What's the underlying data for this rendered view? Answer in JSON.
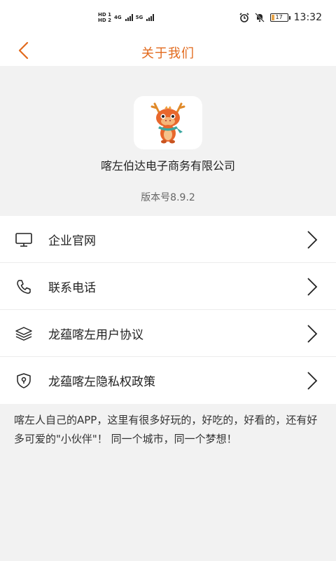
{
  "status_bar": {
    "hd1": "HD 1",
    "hd2": "HD 2",
    "net1": "4G",
    "net2": "5G",
    "battery": "17",
    "time": "13:32",
    "icons": [
      "alarm-icon",
      "mute-icon",
      "battery-icon"
    ]
  },
  "nav": {
    "title": "关于我们",
    "back_icon": "chevron-left-icon",
    "accent_color": "#e26a1d"
  },
  "app": {
    "company": "喀左伯达电子商务有限公司",
    "version": "版本号8.9.2",
    "logo_icon": "dragon-mascot-icon"
  },
  "menu": [
    {
      "label": "企业官网",
      "icon": "monitor-icon"
    },
    {
      "label": "联系电话",
      "icon": "phone-icon"
    },
    {
      "label": "龙蕴喀左用户协议",
      "icon": "layers-icon"
    },
    {
      "label": "龙蕴喀左隐私权政策",
      "icon": "shield-lock-icon"
    }
  ],
  "description": "喀左人自己的APP，这里有很多好玩的，好吃的，好看的，还有好多可爱的\"小伙伴\"！ 同一个城市，同一个梦想！"
}
